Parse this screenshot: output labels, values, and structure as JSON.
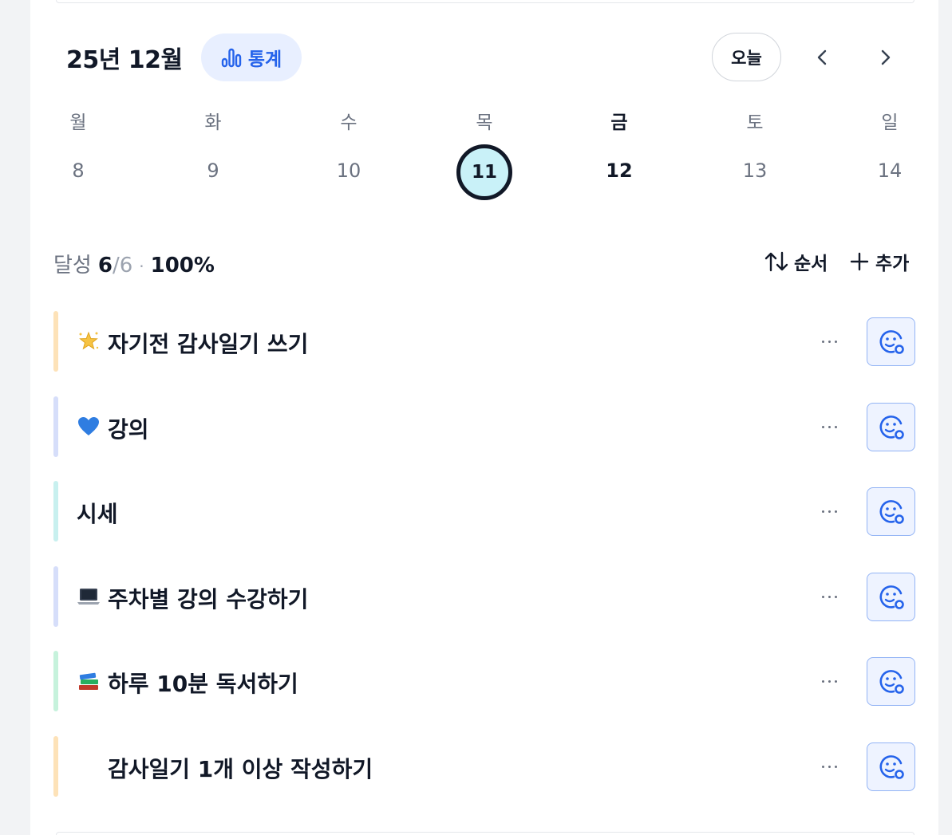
{
  "header": {
    "month_title": "25년 12월",
    "stats_label": "통계",
    "today_label": "오늘"
  },
  "week": {
    "days": [
      {
        "weekday": "월",
        "date": "8"
      },
      {
        "weekday": "화",
        "date": "9"
      },
      {
        "weekday": "수",
        "date": "10"
      },
      {
        "weekday": "목",
        "date": "11"
      },
      {
        "weekday": "금",
        "date": "12"
      },
      {
        "weekday": "토",
        "date": "13"
      },
      {
        "weekday": "일",
        "date": "14"
      }
    ],
    "selected_date": "11",
    "today_weekday": "금"
  },
  "summary": {
    "label": "달성",
    "done": "6",
    "total": "/6",
    "separator": "·",
    "percent": "100%",
    "order_label": "순서",
    "add_label": "추가"
  },
  "habits": [
    {
      "name": "자기전 감사일기 쓰기",
      "icon": "glowing-star-icon",
      "color": "#fde2b8"
    },
    {
      "name": "강의",
      "icon": "blue-heart-icon",
      "color": "#d6defa"
    },
    {
      "name": "시세",
      "icon": "",
      "color": "#c8f0ef"
    },
    {
      "name": "주차별 강의 수강하기",
      "icon": "laptop-icon",
      "color": "#d6defa"
    },
    {
      "name": "하루 10분 독서하기",
      "icon": "books-icon",
      "color": "#c6f2dc"
    },
    {
      "name": "감사일기 1개 이상 작성하기",
      "icon": "",
      "color": "#fde2b8"
    }
  ],
  "colors": {
    "accent": "#2563eb",
    "selected_day_bg": "#c9f1f8",
    "reaction_bg": "#eef3ff"
  }
}
